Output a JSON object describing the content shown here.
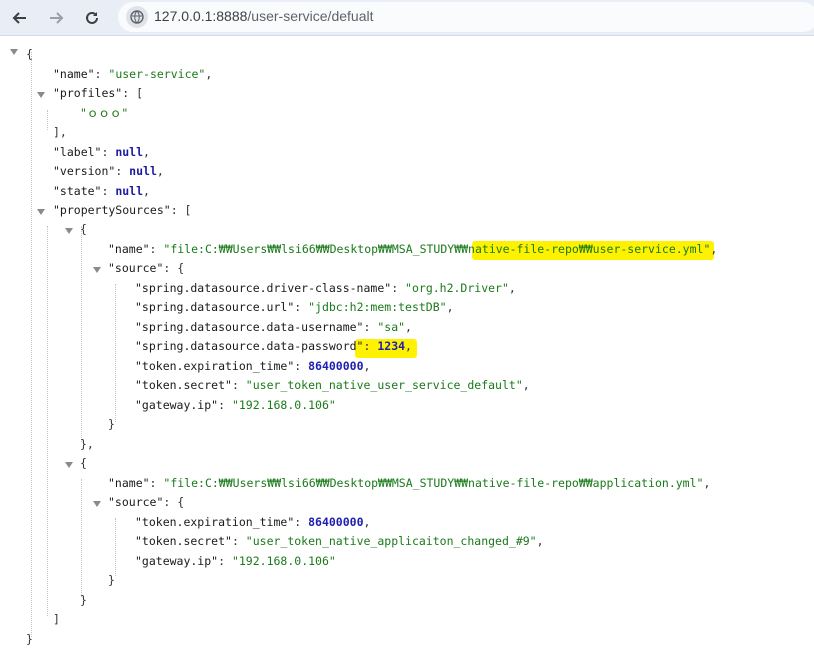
{
  "browser": {
    "url_host": "127.0.0.1:8888",
    "url_path": "/user-service/defualt"
  },
  "json_view": {
    "name_key": "\"name\"",
    "name_value": "\"user-service\"",
    "profiles_key": "\"profiles\"",
    "profiles_item": "\"ｏｏｏ\"",
    "label_key": "\"label\"",
    "version_key": "\"version\"",
    "state_key": "\"state\"",
    "null_value": "null",
    "property_sources_key": "\"propertySources\"",
    "source_key": "\"source\"",
    "ps1_name_value": "\"file:C:₩₩Users₩₩lsi66₩₩Desktop₩₩MSA_STUDY₩₩native-file-repo₩₩user-service.yml\"",
    "ps1_props": [
      {
        "key": "\"spring.datasource.driver-class-name\"",
        "value": "\"org.h2.Driver\"",
        "type": "str"
      },
      {
        "key": "\"spring.datasource.url\"",
        "value": "\"jdbc:h2:mem:testDB\"",
        "type": "str"
      },
      {
        "key": "\"spring.datasource.data-username\"",
        "value": "\"sa\"",
        "type": "str"
      },
      {
        "key": "\"spring.datasource.data-password\"",
        "value": "1234",
        "type": "num"
      },
      {
        "key": "\"token.expiration_time\"",
        "value": "86400000",
        "type": "num"
      },
      {
        "key": "\"token.secret\"",
        "value": "\"user_token_native_user_service_default\"",
        "type": "str"
      },
      {
        "key": "\"gateway.ip\"",
        "value": "\"192.168.0.106\"",
        "type": "str"
      }
    ],
    "ps2_name_value": "\"file:C:₩₩Users₩₩lsi66₩₩Desktop₩₩MSA_STUDY₩₩native-file-repo₩₩application.yml\"",
    "ps2_props": [
      {
        "key": "\"token.expiration_time\"",
        "value": "86400000",
        "type": "num"
      },
      {
        "key": "\"token.secret\"",
        "value": "\"user_token_native_applicaiton_changed_#9\"",
        "type": "str"
      },
      {
        "key": "\"gateway.ip\"",
        "value": "\"192.168.0.106\"",
        "type": "str"
      }
    ]
  },
  "highlight_color": "#fff200",
  "string_color": "#1a7a1a",
  "number_color": "#2020b0"
}
